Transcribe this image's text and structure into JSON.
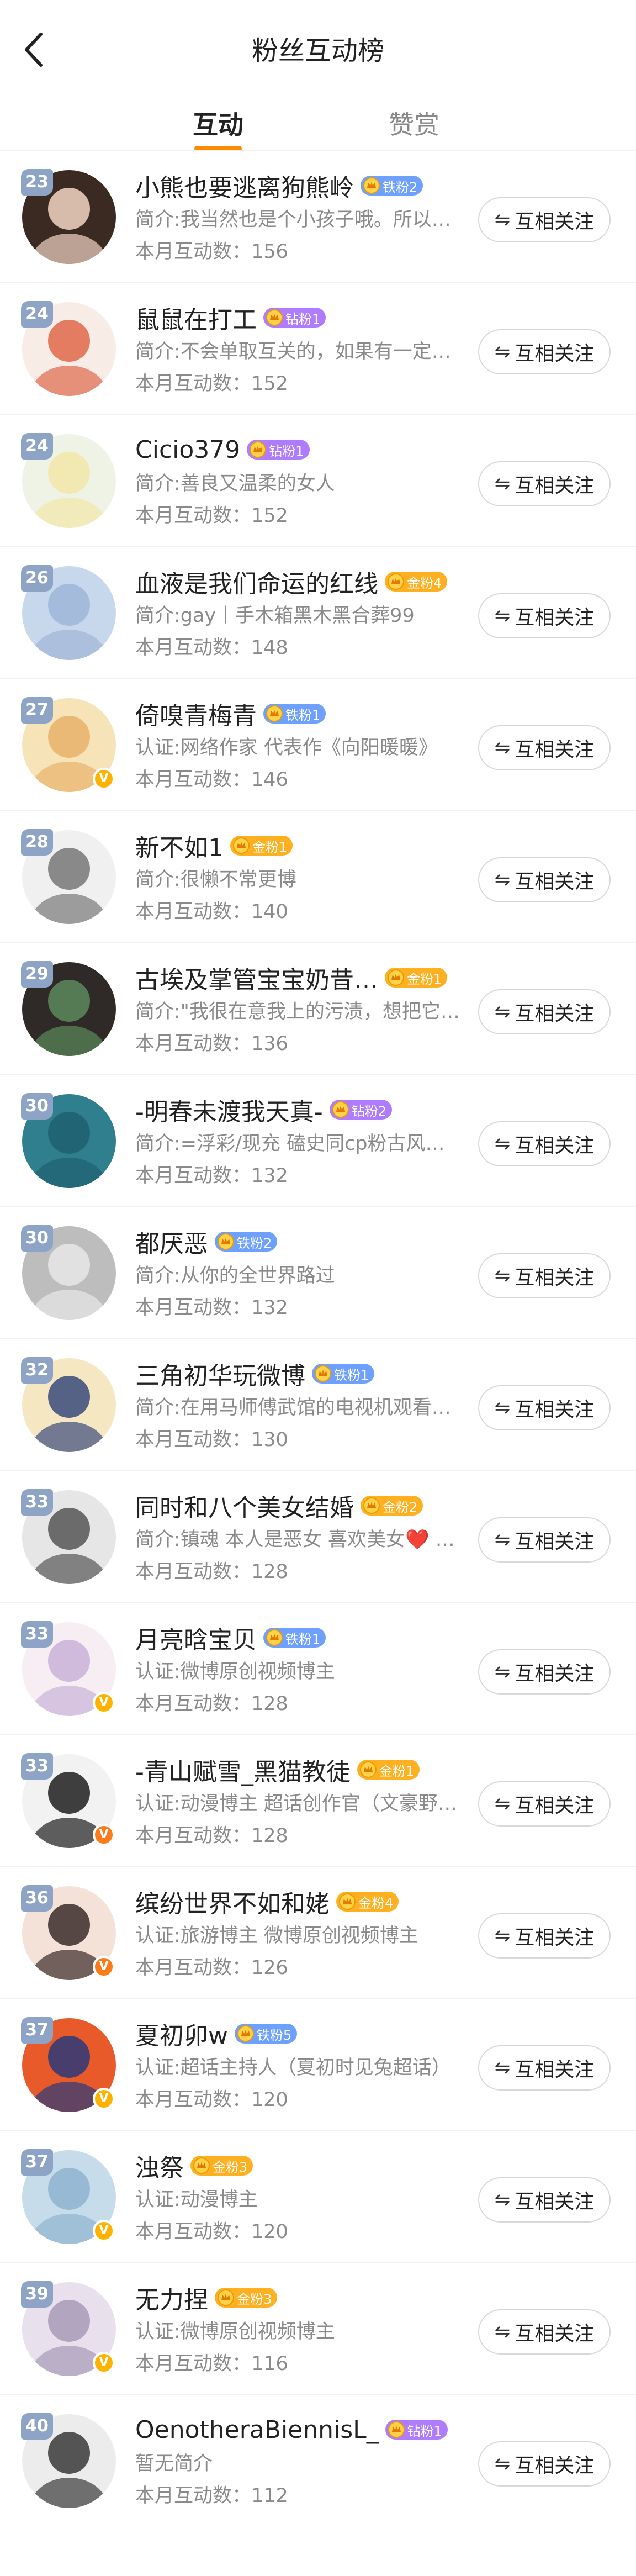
{
  "header": {
    "title": "粉丝互动榜",
    "tabs": [
      "互动",
      "赞赏"
    ]
  },
  "colors": {
    "accent": "#ff8a00",
    "rank_badge": "#8ea4c6",
    "iron": "#6ea0ff",
    "diamond": "#b07cff",
    "gold": "#ffb020"
  },
  "follow_label": "互相关注",
  "rows": [
    {
      "rank": "23",
      "name": "小熊也要逃离狗熊岭",
      "badge": "铁粉2",
      "badge_type": "iron",
      "desc": "简介:我当然也是个小孩子哦。所以这里什么",
      "count": "本月互动数：156",
      "verified": "",
      "avatar_colors": [
        "#3b2a22",
        "#f3d6c4"
      ]
    },
    {
      "rank": "24",
      "name": "鼠鼠在打工",
      "badge": "钻粉1",
      "badge_type": "diamond",
      "desc": "简介:不会单取互关的，如果有一定要关注",
      "count": "本月互动数：152",
      "verified": "",
      "avatar_colors": [
        "#f7ece6",
        "#e0694a"
      ]
    },
    {
      "rank": "24",
      "name": "Cicio379",
      "badge": "钻粉1",
      "badge_type": "diamond",
      "desc": "简介:善良又温柔的女人",
      "count": "本月互动数：152",
      "verified": "",
      "avatar_colors": [
        "#eef3e6",
        "#f2e6a8"
      ]
    },
    {
      "rank": "26",
      "name": "血液是我们命运的红线",
      "badge": "金粉4",
      "badge_type": "gold",
      "desc": "简介:gay丨手木箱黑木黑合葬99",
      "count": "本月互动数：148",
      "verified": "",
      "avatar_colors": [
        "#c8d8ec",
        "#9fb6d8"
      ]
    },
    {
      "rank": "27",
      "name": "倚嗅青梅青",
      "badge": "铁粉1",
      "badge_type": "iron",
      "desc": "认证:网络作家 代表作《向阳暖暖》",
      "count": "本月互动数：146",
      "verified": "yellow",
      "avatar_colors": [
        "#f6e4b8",
        "#e8b26a"
      ]
    },
    {
      "rank": "28",
      "name": "新不如1",
      "badge": "金粉1",
      "badge_type": "gold",
      "desc": "简介:很懒不常更博",
      "count": "本月互动数：140",
      "verified": "",
      "avatar_colors": [
        "#f0f0f0",
        "#777777"
      ]
    },
    {
      "rank": "29",
      "name": "古埃及掌管宝宝奶昔…",
      "badge": "金粉1",
      "badge_type": "gold",
      "desc": "简介:\"我很在意我上的污渍，想把它擦掉\"",
      "count": "本月互动数：136",
      "verified": "",
      "avatar_colors": [
        "#2f2a28",
        "#5a8a5a"
      ]
    },
    {
      "rank": "30",
      "name": "-明春未渡我天真-",
      "badge": "钻粉2",
      "badge_type": "diamond",
      "desc": "简介:=浮彩/现充 磕史同cp粉古风文写手",
      "count": "本月互动数：132",
      "verified": "",
      "avatar_colors": [
        "#2f7f8f",
        "#1f5f6f"
      ]
    },
    {
      "rank": "30",
      "name": "都厌恶",
      "badge": "铁粉2",
      "badge_type": "iron",
      "desc": "简介:从你的全世界路过",
      "count": "本月互动数：132",
      "verified": "",
      "avatar_colors": [
        "#bdbdbd",
        "#e8e8e8"
      ]
    },
    {
      "rank": "32",
      "name": "三角初华玩微博",
      "badge": "铁粉1",
      "badge_type": "iron",
      "desc": "简介:在用马师傅武馆的电视机观看少年跳",
      "count": "本月互动数：130",
      "verified": "",
      "avatar_colors": [
        "#f4e7c2",
        "#3a4a7a"
      ]
    },
    {
      "rank": "33",
      "name": "同时和八个美女结婚",
      "badge": "金粉2",
      "badge_type": "gold",
      "desc": "简介:镇魂 本人是恶女 喜欢美女❤️ 写…",
      "count": "本月互动数：128",
      "verified": "",
      "avatar_colors": [
        "#e6e6e6",
        "#555555"
      ]
    },
    {
      "rank": "33",
      "name": "月亮晗宝贝",
      "badge": "铁粉1",
      "badge_type": "iron",
      "desc": "认证:微博原创视频博主",
      "count": "本月互动数：128",
      "verified": "yellow",
      "avatar_colors": [
        "#f6eef2",
        "#c9b2d9"
      ]
    },
    {
      "rank": "33",
      "name": "-青山赋雪_黑猫教徒",
      "badge": "金粉1",
      "badge_type": "gold",
      "desc": "认证:动漫博主 超话创作官（文豪野犬超",
      "count": "本月互动数：128",
      "verified": "orange",
      "avatar_colors": [
        "#f2f2f2",
        "#1e1e1e"
      ]
    },
    {
      "rank": "36",
      "name": "缤纷世界不如和姥",
      "badge": "金粉4",
      "badge_type": "gold",
      "desc": "认证:旅游博主 微博原创视频博主",
      "count": "本月互动数：126",
      "verified": "orange",
      "avatar_colors": [
        "#f4e2d8",
        "#3a2a2a"
      ]
    },
    {
      "rank": "37",
      "name": "夏初卯w",
      "badge": "铁粉5",
      "badge_type": "iron",
      "desc": "认证:超话主持人（夏初时见兔超话）",
      "count": "本月互动数：120",
      "verified": "yellow",
      "avatar_colors": [
        "#e85a2a",
        "#2a3a7a"
      ]
    },
    {
      "rank": "37",
      "name": "浊祭",
      "badge": "金粉3",
      "badge_type": "gold",
      "desc": "认证:动漫博主",
      "count": "本月互动数：120",
      "verified": "yellow",
      "avatar_colors": [
        "#c7dcea",
        "#8fb3cf"
      ]
    },
    {
      "rank": "39",
      "name": "无力捏",
      "badge": "金粉3",
      "badge_type": "gold",
      "desc": "认证:微博原创视频博主",
      "count": "本月互动数：116",
      "verified": "yellow",
      "avatar_colors": [
        "#e8e0ec",
        "#a89ab8"
      ]
    },
    {
      "rank": "40",
      "name": "OenotheraBiennisL_",
      "badge": "钻粉1",
      "badge_type": "diamond",
      "desc": "暂无简介",
      "count": "本月互动数：112",
      "verified": "",
      "avatar_colors": [
        "#ececec",
        "#3a3a3a"
      ]
    }
  ]
}
